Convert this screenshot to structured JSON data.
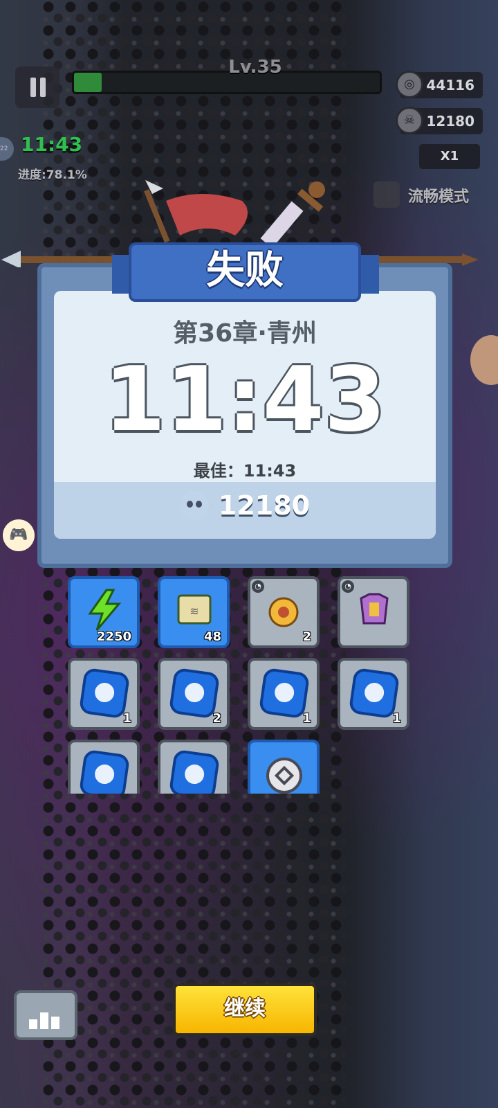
{
  "hud": {
    "level_label": "Lv.35",
    "xp_progress": 0.09,
    "coins": "44116",
    "kills": "12180",
    "speed": "X1",
    "smooth_mode_label": "流畅模式",
    "timer": "11:43",
    "progress_text": "进度:78.1%",
    "badge": "22"
  },
  "result": {
    "title": "失败",
    "chapter": "第36章·青州",
    "time": "11:43",
    "best": "最佳：11:43",
    "kills": "12180"
  },
  "rewards": [
    {
      "name": "energy",
      "qty": "2250",
      "style": "blue"
    },
    {
      "name": "scroll",
      "qty": "48",
      "style": "blue"
    },
    {
      "name": "amulet",
      "qty": "2",
      "style": "grey"
    },
    {
      "name": "armor",
      "qty": "",
      "style": "grey"
    },
    {
      "name": "helmet-gem",
      "qty": "1",
      "style": "grey"
    },
    {
      "name": "medal-gem",
      "qty": "2",
      "style": "grey"
    },
    {
      "name": "gauntlet-gem",
      "qty": "1",
      "style": "grey"
    },
    {
      "name": "sword-gem",
      "qty": "1",
      "style": "grey"
    },
    {
      "name": "boot-gem",
      "qty": "",
      "style": "grey"
    },
    {
      "name": "armor-gem",
      "qty": "",
      "style": "grey"
    },
    {
      "name": "coin",
      "qty": "",
      "style": "blue"
    }
  ],
  "buttons": {
    "continue": "继续"
  },
  "colors": {
    "banner_blue": "#3f70c4",
    "continue_yellow": "#ffd21f",
    "timer_green": "#30c050"
  }
}
